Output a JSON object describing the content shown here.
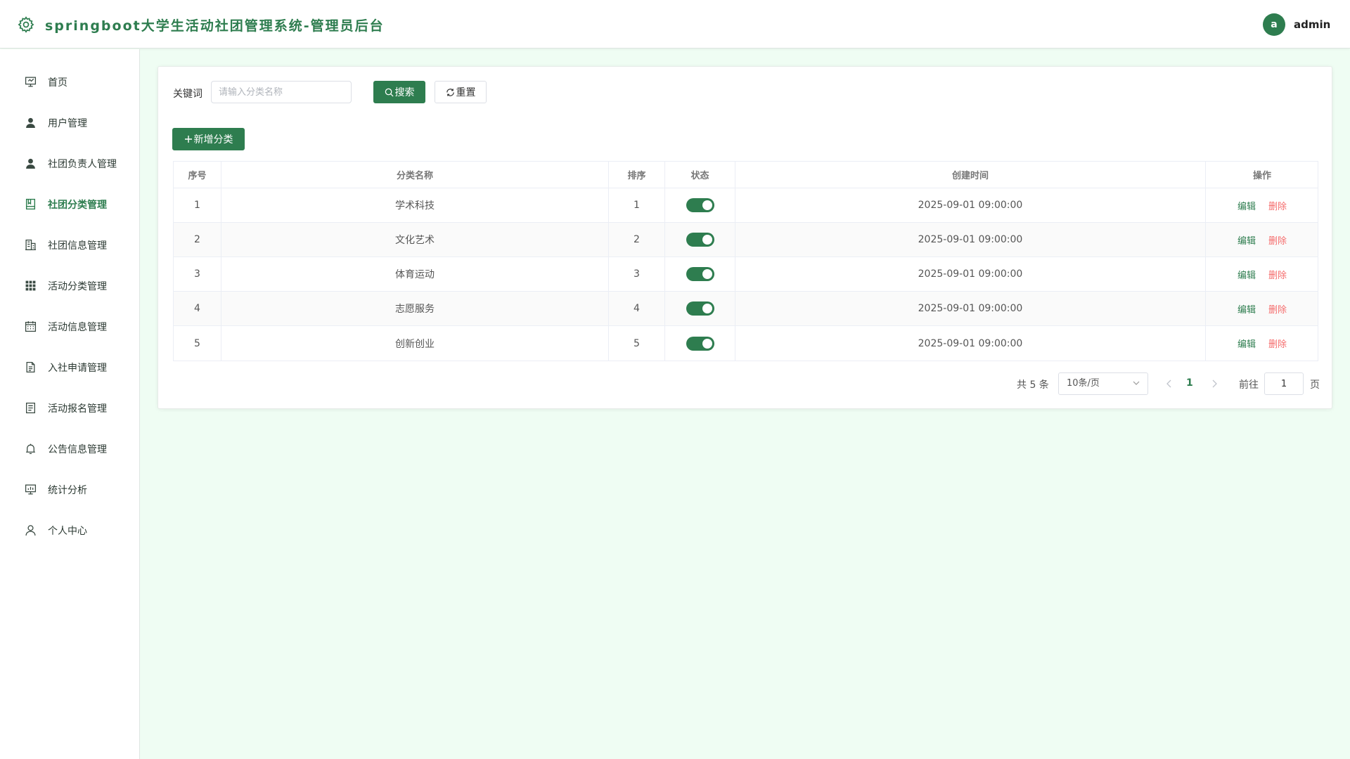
{
  "header": {
    "title": "springboot大学生活动社团管理系统-管理员后台",
    "avatar_letter": "a",
    "username": "admin",
    "logo_icon": "gear-icon"
  },
  "sidebar": {
    "items": [
      {
        "label": "首页",
        "icon": "presentation-icon",
        "active": false
      },
      {
        "label": "用户管理",
        "icon": "user-filled-icon",
        "active": false
      },
      {
        "label": "社团负责人管理",
        "icon": "user-filled-icon",
        "active": false
      },
      {
        "label": "社团分类管理",
        "icon": "notebook-icon",
        "active": true
      },
      {
        "label": "社团信息管理",
        "icon": "office-building-icon",
        "active": false
      },
      {
        "label": "活动分类管理",
        "icon": "grid-icon",
        "active": false
      },
      {
        "label": "活动信息管理",
        "icon": "calendar-icon",
        "active": false
      },
      {
        "label": "入社申请管理",
        "icon": "document-icon",
        "active": false
      },
      {
        "label": "活动报名管理",
        "icon": "tickets-icon",
        "active": false
      },
      {
        "label": "公告信息管理",
        "icon": "bell-icon",
        "active": false
      },
      {
        "label": "统计分析",
        "icon": "data-board-icon",
        "active": false
      },
      {
        "label": "个人中心",
        "icon": "user-outline-icon",
        "active": false
      }
    ]
  },
  "search": {
    "label": "关键词",
    "placeholder": "请输入分类名称",
    "value": "",
    "search_button": "搜索",
    "reset_button": "重置"
  },
  "toolbar": {
    "add_button": "新增分类"
  },
  "table": {
    "columns": [
      "序号",
      "分类名称",
      "排序",
      "状态",
      "创建时间",
      "操作"
    ],
    "rows": [
      {
        "index": "1",
        "name": "学术科技",
        "sort": "1",
        "status": true,
        "created": "2025-09-01 09:00:00"
      },
      {
        "index": "2",
        "name": "文化艺术",
        "sort": "2",
        "status": true,
        "created": "2025-09-01 09:00:00"
      },
      {
        "index": "3",
        "name": "体育运动",
        "sort": "3",
        "status": true,
        "created": "2025-09-01 09:00:00"
      },
      {
        "index": "4",
        "name": "志愿服务",
        "sort": "4",
        "status": true,
        "created": "2025-09-01 09:00:00"
      },
      {
        "index": "5",
        "name": "创新创业",
        "sort": "5",
        "status": true,
        "created": "2025-09-01 09:00:00"
      }
    ],
    "edit_label": "编辑",
    "delete_label": "删除"
  },
  "pagination": {
    "total_text": "共 5 条",
    "page_size": "10条/页",
    "current_page": "1",
    "goto_label": "前往",
    "goto_value": "1",
    "page_suffix": "页"
  },
  "colors": {
    "primary": "#2e7d4f",
    "danger": "#f56c6c",
    "background": "#effdf3"
  }
}
